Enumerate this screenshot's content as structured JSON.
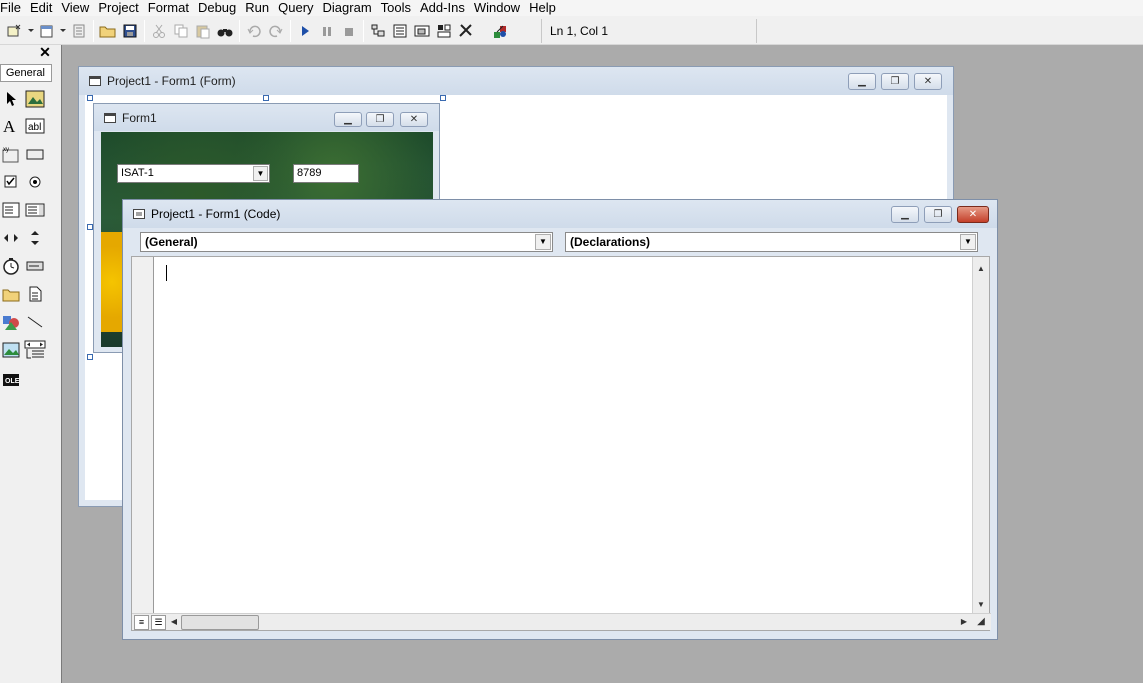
{
  "menu": [
    "File",
    "Edit",
    "View",
    "Project",
    "Format",
    "Debug",
    "Run",
    "Query",
    "Diagram",
    "Tools",
    "Add-Ins",
    "Window",
    "Help"
  ],
  "toolbar": {
    "status": "Ln 1, Col 1"
  },
  "toolbox": {
    "tab_label": "General",
    "close_glyph": "✕"
  },
  "form_designer": {
    "title": "Project1 - Form1 (Form)",
    "form": {
      "title": "Form1",
      "combo_value": "ISAT-1",
      "textbox_value": "8789"
    }
  },
  "code_window": {
    "title": "Project1 - Form1 (Code)",
    "object_combo": "(General)",
    "procedure_combo": "(Declarations)"
  },
  "colors": {
    "mdi_background": "#ababab",
    "title_gradient": "#cfdbea",
    "close_red": "#c4402a"
  }
}
